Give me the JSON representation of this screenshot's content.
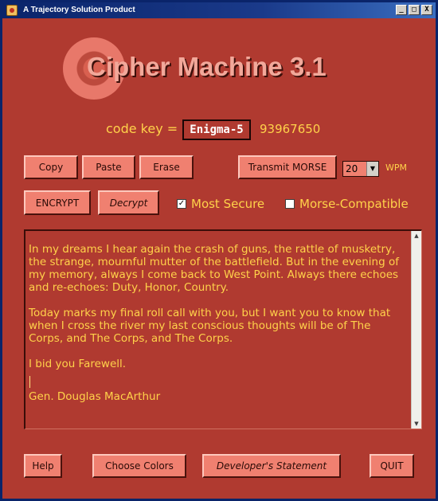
{
  "window": {
    "title": "A Trajectory Solution Product",
    "minimize": "_",
    "maximize": "□",
    "close": "X"
  },
  "logo": {
    "text": "Cipher Machine 3.1"
  },
  "codekey": {
    "label": "code key =",
    "value": "Enigma-5",
    "number": "93967650"
  },
  "toolbar": {
    "copy": "Copy",
    "paste": "Paste",
    "erase": "Erase",
    "transmit": "Transmit MORSE",
    "wpm_value": "20",
    "wpm_label": "WPM"
  },
  "actions": {
    "encrypt": "ENCRYPT",
    "decrypt": "Decrypt",
    "most_secure": {
      "label": "Most Secure",
      "checked": true,
      "mark": "✓"
    },
    "morse_compatible": {
      "label": "Morse-Compatible",
      "checked": false
    }
  },
  "message": {
    "para1": "In my dreams I hear again the crash of guns, the rattle of musketry, the strange, mournful mutter of the battlefield. But in the evening of my memory, always I come back to West Point. Always there echoes and re-echoes: Duty, Honor, Country.",
    "para2": "Today marks my final roll call with you, but I want you to know that when I cross the river my last conscious thoughts will be of The Corps, and The Corps, and The Corps.",
    "para3": "I bid you Farewell.",
    "signature": "Gen. Douglas MacArthur"
  },
  "footer": {
    "help": "Help",
    "choose_colors": "Choose Colors",
    "developer": "Developer's Statement",
    "quit": "QUIT"
  },
  "colors": {
    "background": "#b03a30",
    "button": "#f08070",
    "accent_text": "#ffd24a",
    "title_bar": "#0a246a"
  }
}
